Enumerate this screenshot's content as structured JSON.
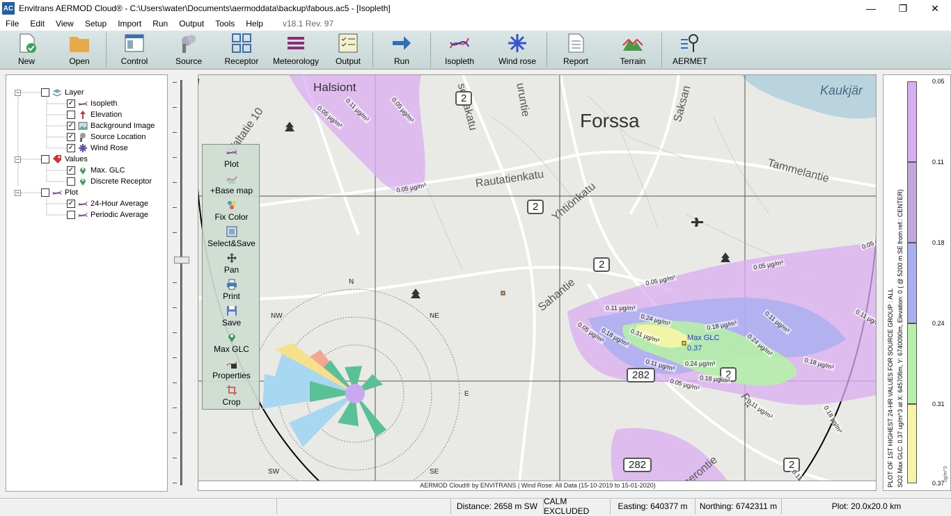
{
  "window": {
    "title": "Envitrans AERMOD Cloud® - C:\\Users\\water\\Documents\\aermoddata\\backup\\fabous.ac5 - [Isopleth]",
    "app_icon": "AC",
    "minimize": "—",
    "restore": "❐",
    "close": "✕"
  },
  "menu": {
    "items": [
      "File",
      "Edit",
      "View",
      "Setup",
      "Import",
      "Run",
      "Output",
      "Tools",
      "Help"
    ],
    "version": "v18.1 Rev. 97"
  },
  "toolbar": {
    "new": "New",
    "open": "Open",
    "control": "Control",
    "source": "Source",
    "receptor": "Receptor",
    "meteorology": "Meteorology",
    "output": "Output",
    "run": "Run",
    "isopleth": "Isopleth",
    "wind_rose": "Wind rose",
    "report": "Report",
    "terrain": "Terrain",
    "aermet": "AERMET"
  },
  "tree": {
    "layer": "Layer",
    "isopleth": "Isopleth",
    "elevation": "Elevation",
    "background_image": "Background Image",
    "source_location": "Source Location",
    "wind_rose": "Wind Rose",
    "values": "Values",
    "max_glc": "Max. GLC",
    "discrete_receptor": "Discrete Receptor",
    "plot": "Plot",
    "avg_24h": "24-Hour Average",
    "periodic_avg": "Periodic Average",
    "checked": {
      "isopleth": true,
      "elevation": false,
      "background_image": true,
      "source_location": true,
      "wind_rose": true,
      "max_glc": true,
      "discrete_receptor": false,
      "avg_24h": true,
      "periodic_avg": false
    }
  },
  "float_tools": {
    "plot": "Plot",
    "base_map": "+Base map",
    "fix_color": "Fix Color",
    "select_save": "Select&Save",
    "pan": "Pan",
    "print": "Print",
    "save": "Save",
    "max_glc": "Max GLC",
    "properties": "Properties",
    "crop": "Crop"
  },
  "map": {
    "place_labels": {
      "forssa": "Forssa",
      "halsiont": "Halsiont",
      "kaukjar": "Kaukjär",
      "valtatie": "Valtatie 10",
      "semakatu": "semakatu",
      "uruntie": "uruntie",
      "saksan": "Saksan",
      "rautatienkatu": "Rautatienkatu",
      "yhtionkatu": "Yhtiönkatu",
      "tammelantie": "Tammelantie",
      "sahantie": "Sahantie",
      "merontie": "merontie",
      "pa": "Pa",
      "pe": "e"
    },
    "road_badges": [
      "2",
      "2",
      "2",
      "282",
      "2",
      "2",
      "282"
    ],
    "rose_dirs": {
      "n": "N",
      "ne": "NE",
      "e": "E",
      "se": "SE",
      "sw": "SW",
      "nw": "NW"
    },
    "iso_labels": {
      "a": "0.05 µg/m³",
      "b": "0.11 µg/m³",
      "c": "0.05 µg/m³",
      "d": "0.05 µg/m³",
      "e": "0.05 µg/m³",
      "f": "0.05 µg/m³",
      "g": "0.11 µg/m³",
      "h": "0.24 µg/m³",
      "i": "0.18 µg/m³",
      "j": "0.05 µg/m³",
      "k": "0.18 µg/m³",
      "l": "0.31 µg/m³",
      "m": "0.24 µg/m³",
      "n": "0.11 µg/m³",
      "o": "0.18 µg/m³",
      "p": "0.11 µg/m³",
      "q": "0.24 µg/m³",
      "r": "0.18 µg/m³",
      "s": "0.05 µg/m³",
      "t": "0.11 µg/m³",
      "u": "0.18 µg/m³",
      "v": "0.11 µg/m³",
      "w": "0.05 µg/m³",
      "x": "0.11 µg/m³"
    },
    "max_glc_label": "Max GLC",
    "max_glc_value": "0.37",
    "footer": "AERMOD Cloud® by ENVITRANS | Wind Rose: All Data (15-10-2019 to 15-01-2020)"
  },
  "legend": {
    "ticks": [
      "0.05",
      "0.11",
      "0.18",
      "0.24",
      "0.31",
      "0.37"
    ],
    "colors": [
      "#d9aef0",
      "#c1a8da",
      "#a9aef0",
      "#b6f0a9",
      "#f6f4a8"
    ],
    "title": "PLOT OF 1ST HIGHEST 24-HR VALUES FOR SOURCE GROUP : ALL",
    "subtitle": "SO2 Max GLC: 0.37 ug/m^3 at X: 645708m, Y: 6740090m, Elevation: 0 ( @ 5200 m SE from ref.: CENTER)",
    "unit": "ug/m^3"
  },
  "status": {
    "distance": "Distance: 2658 m SW",
    "calm": "CALM EXCLUDED",
    "easting": "Easting: 640377 m",
    "northing": "Northing: 6742311 m",
    "plot": "Plot: 20.0x20.0 km"
  }
}
